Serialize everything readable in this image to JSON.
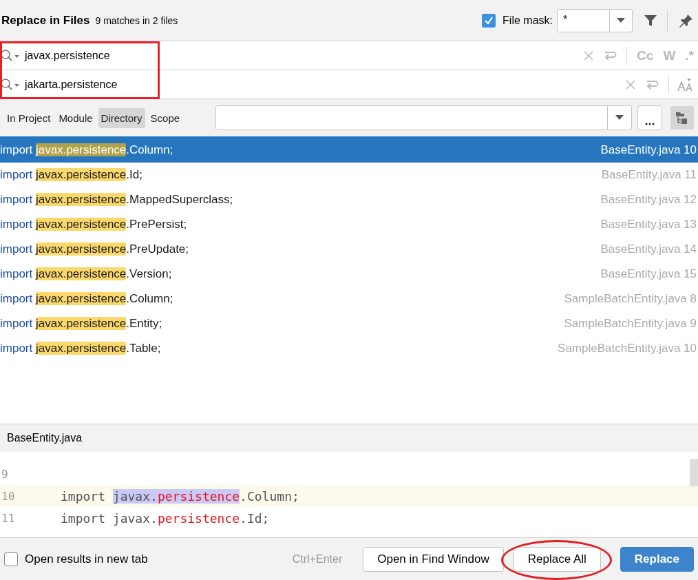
{
  "header": {
    "title": "Replace in Files",
    "summary": "9 matches in 2 files",
    "file_mask": {
      "checked": true,
      "label": "File mask:",
      "value": "*"
    }
  },
  "find": {
    "value": "javax.persistence",
    "options": [
      "Cc",
      "W",
      ".*"
    ]
  },
  "replace": {
    "value": "jakarta.persistence"
  },
  "fields_annotated": true,
  "scopes": [
    {
      "label": "In Project",
      "selected": false
    },
    {
      "label": "Module",
      "selected": false
    },
    {
      "label": "Directory",
      "selected": true
    },
    {
      "label": "Scope",
      "selected": false
    }
  ],
  "results": [
    {
      "prefix": "import ",
      "match": "javax.persistence",
      "rest": ".Column;",
      "file": "BaseEntity.java",
      "line": "10",
      "selected": true
    },
    {
      "prefix": "import ",
      "match": "javax.persistence",
      "rest": ".Id;",
      "file": "BaseEntity.java",
      "line": "11",
      "selected": false
    },
    {
      "prefix": "import ",
      "match": "javax.persistence",
      "rest": ".MappedSuperclass;",
      "file": "BaseEntity.java",
      "line": "12",
      "selected": false
    },
    {
      "prefix": "import ",
      "match": "javax.persistence",
      "rest": ".PrePersist;",
      "file": "BaseEntity.java",
      "line": "13",
      "selected": false
    },
    {
      "prefix": "import ",
      "match": "javax.persistence",
      "rest": ".PreUpdate;",
      "file": "BaseEntity.java",
      "line": "14",
      "selected": false
    },
    {
      "prefix": "import ",
      "match": "javax.persistence",
      "rest": ".Version;",
      "file": "BaseEntity.java",
      "line": "15",
      "selected": false
    },
    {
      "prefix": "import ",
      "match": "javax.persistence",
      "rest": ".Column;",
      "file": "SampleBatchEntity.java",
      "line": "8",
      "selected": false
    },
    {
      "prefix": "import ",
      "match": "javax.persistence",
      "rest": ".Entity;",
      "file": "SampleBatchEntity.java",
      "line": "9",
      "selected": false
    },
    {
      "prefix": "import ",
      "match": "javax.persistence",
      "rest": ".Table;",
      "file": "SampleBatchEntity.java",
      "line": "10",
      "selected": false
    }
  ],
  "preview": {
    "file": "BaseEntity.java",
    "lines": [
      {
        "number": "9",
        "current": false
      },
      {
        "number": "10",
        "current": true,
        "segments": [
          {
            "text": "import ",
            "kind": "plain"
          },
          {
            "text": "javax.",
            "kind": "match"
          },
          {
            "text": "persistence",
            "kind": "match-key"
          },
          {
            "text": ".Column;",
            "kind": "plain"
          }
        ]
      },
      {
        "number": "11",
        "current": false,
        "segments": [
          {
            "text": "import javax.",
            "kind": "plain"
          },
          {
            "text": "persistence",
            "kind": "key"
          },
          {
            "text": ".Id;",
            "kind": "plain"
          }
        ]
      }
    ]
  },
  "footer": {
    "new_tab": {
      "checked": false,
      "label": "Open results in new tab"
    },
    "shortcut": "Ctrl+Enter",
    "buttons": [
      {
        "label": "Open in Find Window",
        "kind": "secondary",
        "circled": false
      },
      {
        "label": "Replace All",
        "kind": "secondary",
        "circled": true
      },
      {
        "label": "Replace",
        "kind": "primary",
        "circled": false
      }
    ]
  }
}
